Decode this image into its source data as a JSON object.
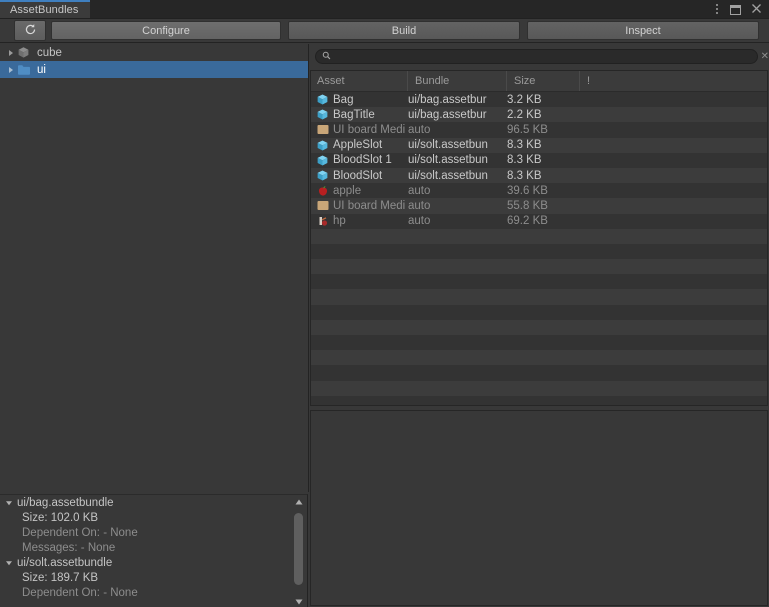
{
  "window": {
    "tab_label": "AssetBundles",
    "controls": {
      "menu": "kebab-menu",
      "maximize": "maximize",
      "close": "✕"
    }
  },
  "toolbar": {
    "refresh_label": "refresh-icon",
    "configure_label": "Configure",
    "build_label": "Build",
    "inspect_label": "Inspect"
  },
  "tree": {
    "items": [
      {
        "label": "cube",
        "icon": "prefab-box-icon",
        "selected": false,
        "expanded": false
      },
      {
        "label": "ui",
        "icon": "folder-icon",
        "selected": true,
        "expanded": false
      }
    ]
  },
  "search": {
    "value": "",
    "placeholder": "",
    "icon": "search-icon",
    "clear_label": "✕"
  },
  "asset_list": {
    "columns": [
      {
        "label": "Asset"
      },
      {
        "label": "Bundle"
      },
      {
        "label": "Size"
      },
      {
        "label": "!"
      }
    ],
    "rows": [
      {
        "asset": "Bag",
        "bundle": "ui/bag.assetbur",
        "size": "3.2 KB",
        "icon": "prefab-icon",
        "dim": false
      },
      {
        "asset": "BagTitle",
        "bundle": "ui/bag.assetbur",
        "size": "2.2 KB",
        "icon": "prefab-icon",
        "dim": false
      },
      {
        "asset": "UI board Medi",
        "bundle": "auto",
        "size": "96.5 KB",
        "icon": "texture-tan-icon",
        "dim": true
      },
      {
        "asset": "AppleSlot",
        "bundle": "ui/solt.assetbun",
        "size": "8.3 KB",
        "icon": "prefab-icon",
        "dim": false
      },
      {
        "asset": "BloodSlot 1",
        "bundle": "ui/solt.assetbun",
        "size": "8.3 KB",
        "icon": "prefab-icon",
        "dim": false
      },
      {
        "asset": "BloodSlot",
        "bundle": "ui/solt.assetbun",
        "size": "8.3 KB",
        "icon": "prefab-icon",
        "dim": false
      },
      {
        "asset": "apple",
        "bundle": "auto",
        "size": "39.6 KB",
        "icon": "apple-texture-icon",
        "dim": true
      },
      {
        "asset": "UI board Medi",
        "bundle": "auto",
        "size": "55.8 KB",
        "icon": "texture-tan-icon",
        "dim": true
      },
      {
        "asset": "hp",
        "bundle": "auto",
        "size": "69.2 KB",
        "icon": "hp-texture-icon",
        "dim": true
      }
    ],
    "empty_row_count": 13
  },
  "bundle_details": {
    "entries": [
      {
        "name": "ui/bag.assetbundle",
        "size": "Size: 102.0 KB",
        "dependent": "Dependent On: - None",
        "messages": "Messages: - None"
      },
      {
        "name": "ui/solt.assetbundle",
        "size": "Size: 189.7 KB",
        "dependent": "Dependent On: - None",
        "messages": ""
      }
    ],
    "scroll_up": "scroll-up-arrow",
    "scroll_down": "scroll-down-arrow"
  },
  "colors": {
    "accent": "#3f7fbf",
    "selection": "#3a6a9b",
    "panel_bg": "#383838",
    "list_bg": "#333333",
    "row_alt": "#3c3c3c"
  }
}
